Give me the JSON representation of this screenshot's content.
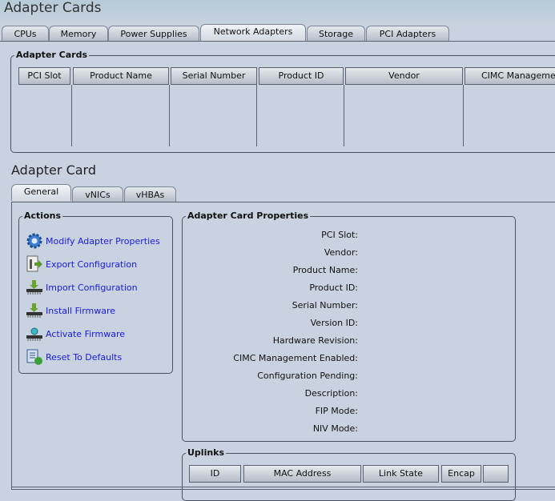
{
  "page": {
    "title": "Adapter Cards"
  },
  "top_tabs": [
    {
      "label": "CPUs"
    },
    {
      "label": "Memory"
    },
    {
      "label": "Power Supplies"
    },
    {
      "label": "Network Adapters",
      "active": true
    },
    {
      "label": "Storage"
    },
    {
      "label": "PCI Adapters"
    }
  ],
  "adapter_cards_table": {
    "legend": "Adapter Cards",
    "columns": [
      "PCI Slot",
      "Product Name",
      "Serial Number",
      "Product ID",
      "Vendor",
      "CIMC Management Enabled"
    ],
    "rows": []
  },
  "adapter_card": {
    "title": "Adapter Card",
    "tabs": [
      {
        "label": "General",
        "active": true
      },
      {
        "label": "vNICs"
      },
      {
        "label": "vHBAs"
      }
    ]
  },
  "actions": {
    "legend": "Actions",
    "items": [
      {
        "label": "Modify Adapter Properties",
        "icon": "gear-icon"
      },
      {
        "label": "Export Configuration",
        "icon": "export-icon"
      },
      {
        "label": "Import Configuration",
        "icon": "import-icon"
      },
      {
        "label": "Install Firmware",
        "icon": "install-firmware-icon"
      },
      {
        "label": "Activate Firmware",
        "icon": "activate-firmware-icon"
      },
      {
        "label": "Reset To Defaults",
        "icon": "reset-icon"
      }
    ]
  },
  "properties": {
    "legend": "Adapter Card Properties",
    "fields": [
      "PCI Slot:",
      "Vendor:",
      "Product Name:",
      "Product ID:",
      "Serial Number:",
      "Version ID:",
      "Hardware Revision:",
      "CIMC Management Enabled:",
      "Configuration Pending:",
      "Description:",
      "FIP Mode:",
      "NIV Mode:"
    ]
  },
  "uplinks": {
    "legend": "Uplinks",
    "columns": [
      "ID",
      "MAC Address",
      "Link State",
      "Encap",
      ""
    ]
  },
  "colors": {
    "background": "#c9d2e0",
    "link": "#1a1ae6"
  }
}
